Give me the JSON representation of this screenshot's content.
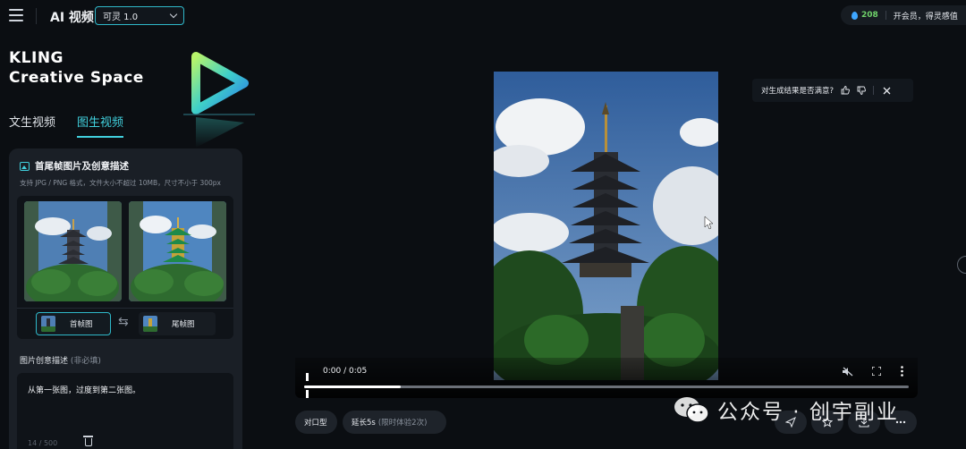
{
  "header": {
    "app_title": "AI 视频",
    "model_select": "可灵 1.0",
    "points": "208",
    "vip_text": "开会员，得灵感值"
  },
  "brand": {
    "line1": "KLING",
    "line2": "Creative Space"
  },
  "mode_tabs": [
    {
      "label": "文生视频",
      "active": false
    },
    {
      "label": "图生视频",
      "active": true
    }
  ],
  "panel": {
    "title": "首尾帧图片及创意描述",
    "hint": "支持 JPG / PNG 格式，文件大小不超过 10MB，尺寸不小于 300px",
    "first_frame_label": "首帧图",
    "last_frame_label": "尾帧图",
    "prompt_label": "图片创意描述",
    "prompt_optional": "(非必填)",
    "prompt_text": "从第一张图，过度到第二张图。",
    "counter": "14 / 500"
  },
  "player": {
    "time": "0:00 / 0:05",
    "progress": 0.16
  },
  "feedback": {
    "question": "对生成结果是否满意?"
  },
  "actions": {
    "lip_sync": "对口型",
    "extend": "延长5s",
    "extend_note": "(限时体验2次)"
  },
  "watermark": {
    "text": "公众号 · 创宇副业"
  },
  "colors": {
    "accent": "#41d0dd",
    "points": "#6fd26a",
    "background": "#0b0e12"
  }
}
